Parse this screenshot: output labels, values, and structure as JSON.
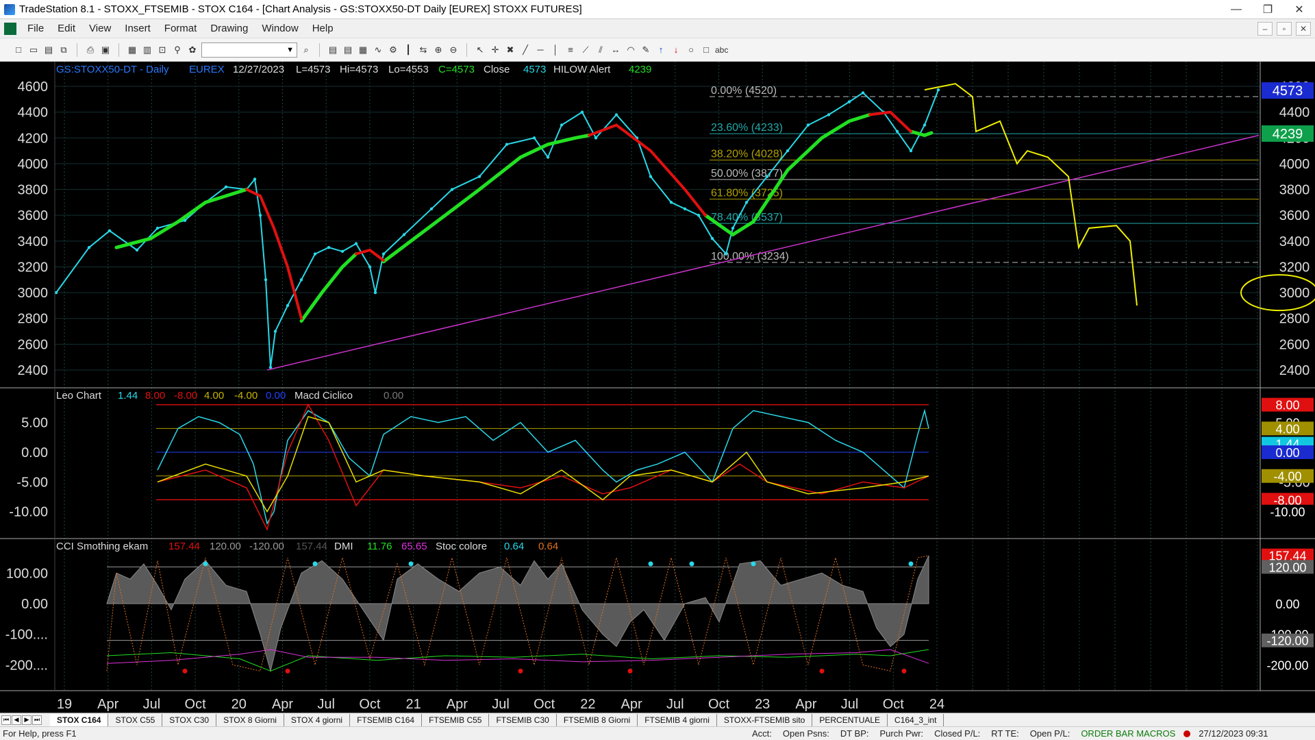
{
  "window": {
    "title": "TradeStation 8.1 - STOXX_FTSEMIB - STOX C164 - [Chart Analysis - GS:STOXX50-DT  Daily  [EUREX] STOXX FUTURES]",
    "minimize": "—",
    "maximize": "❐",
    "close": "✕"
  },
  "menu": {
    "items": [
      "File",
      "Edit",
      "View",
      "Insert",
      "Format",
      "Drawing",
      "Window",
      "Help"
    ],
    "mdi": [
      "–",
      "▫",
      "✕"
    ]
  },
  "toolbar": {
    "text_tool": "abc"
  },
  "chart": {
    "price_header": {
      "symbol": "GS:STOXX50-DT - Daily",
      "exchange": "EUREX",
      "date": "12/27/2023",
      "last": "L=4573",
      "high": "Hi=4573",
      "low": "Lo=4553",
      "close": "C=4573",
      "close_label": "Close",
      "close_val": "4573",
      "hilow_label": "HILOW Alert",
      "hilow_val": "4239"
    },
    "price_axis": [
      "4600",
      "4400",
      "4200",
      "4000",
      "3800",
      "3600",
      "3400",
      "3200",
      "3000",
      "2800",
      "2600",
      "2400"
    ],
    "price_badges": {
      "last": "4573",
      "hilow": "4239"
    },
    "fib_levels": [
      {
        "label": "0.00% (4520)",
        "value": 4520
      },
      {
        "label": "23.60% (4233)",
        "value": 4233
      },
      {
        "label": "38.20% (4028)",
        "value": 4028
      },
      {
        "label": "50.00% (3877)",
        "value": 3877
      },
      {
        "label": "61.80% (3725)",
        "value": 3725
      },
      {
        "label": "78.40% (3537)",
        "value": 3537
      },
      {
        "label": "100.00% (3234)",
        "value": 3234
      }
    ],
    "osc_header": {
      "name": "Leo Chart",
      "v1": "1.44",
      "v2": "8.00",
      "v3": "-8.00",
      "v4": "4.00",
      "v5": "-4.00",
      "v6": "0.00",
      "macd_name": "Macd Ciclico",
      "macd_val": "0.00"
    },
    "osc_axis": [
      "5.00",
      "0.00",
      "-5.00",
      "-10.00"
    ],
    "osc_badges": [
      "8.00",
      "5.00",
      "4.00",
      "1.44",
      "0.00",
      "-4.00",
      "-8.00",
      "-10.00"
    ],
    "cci_header": {
      "name": "CCI Smothing ekam",
      "v1": "157.44",
      "v2": "120.00",
      "v3": "-120.00",
      "v4": "157.44",
      "dmi_name": "DMI",
      "dmi_v1": "11.76",
      "dmi_v2": "65.65",
      "stoc_name": "Stoc colore",
      "stoc_v1": "0.64",
      "stoc_v2": "0.64"
    },
    "cci_axis": [
      "100.00",
      "0.00",
      "-100....",
      "-200...."
    ],
    "cci_badges": [
      "157.44",
      "120.00",
      "0.00",
      "-100.00",
      "-120.00",
      "-200.00"
    ],
    "time_axis": [
      "19",
      "Apr",
      "Jul",
      "Oct",
      "20",
      "Apr",
      "Jul",
      "Oct",
      "21",
      "Apr",
      "Jul",
      "Oct",
      "22",
      "Apr",
      "Jul",
      "Oct",
      "23",
      "Apr",
      "Jul",
      "Oct",
      "24"
    ],
    "colors": {
      "price": "#29d8e8",
      "ma_up": "#22e022",
      "ma_down": "#e01010",
      "trend": "#cc33cc",
      "projection": "#f0f000",
      "fib": "#22aaaa"
    }
  },
  "tabs": [
    "STOX C164",
    "STOX C55",
    "STOX C30",
    "STOX 8 Giorni",
    "STOX 4 giorni",
    "FTSEMIB C164",
    "FTSEMIB C55",
    "FTSEMIB C30",
    "FTSEMIB 8 Giorni",
    "FTSEMIB 4 giorni",
    "STOXX-FTSEMIB sito",
    "PERCENTUALE",
    "C164_3_int"
  ],
  "status": {
    "help": "For Help, press F1",
    "fields": [
      "Acct:",
      "Open Psns:",
      "DT BP:",
      "Purch Pwr:",
      "Closed P/L:",
      "RT TE:",
      "Open P/L:"
    ],
    "macros": "ORDER BAR  MACROS",
    "datetime": "27/12/2023 09:31"
  }
}
